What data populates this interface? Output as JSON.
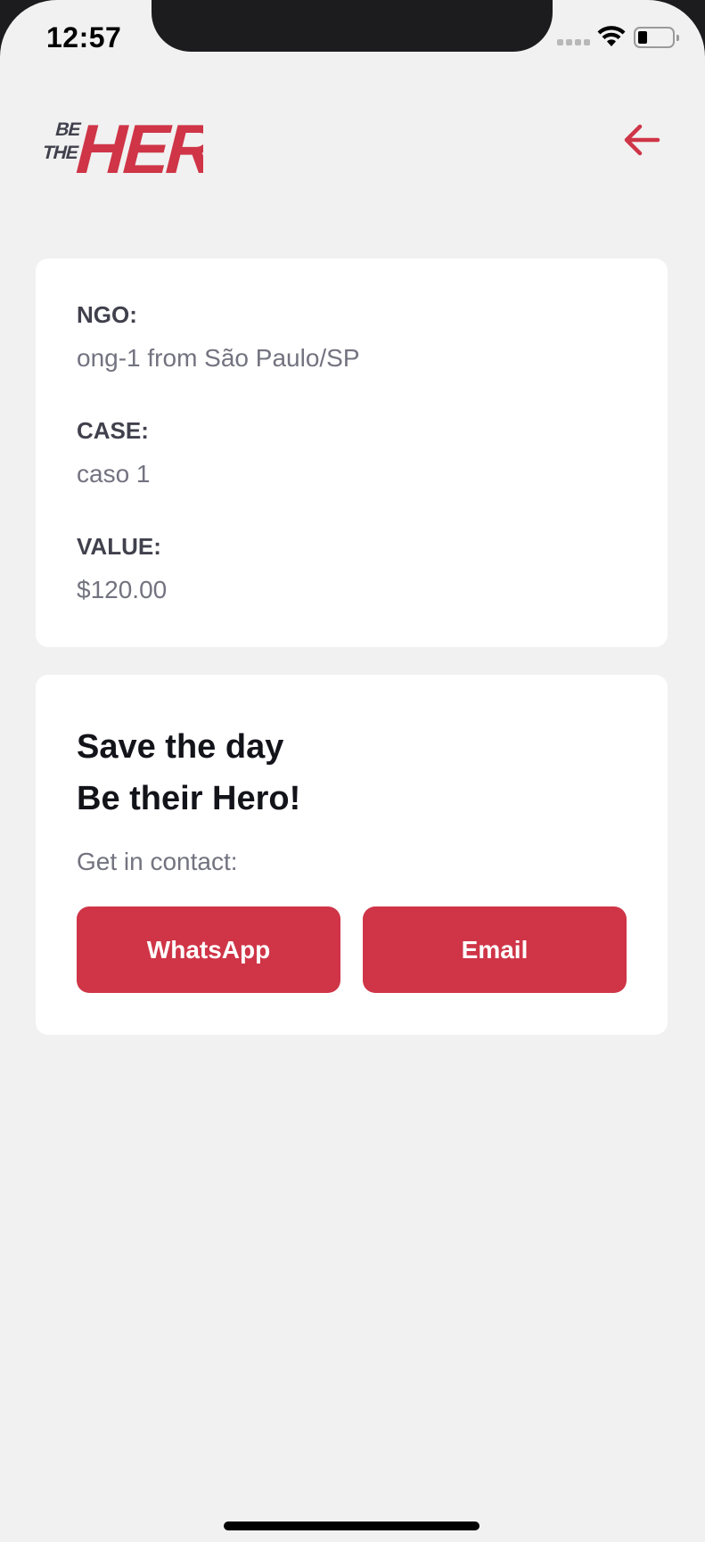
{
  "status_bar": {
    "time": "12:57"
  },
  "header": {
    "logo_alt": "BE THE HERO",
    "back_icon": "arrow-left-icon"
  },
  "incident": {
    "ngo_label": "NGO:",
    "ngo_value": "ong-1 from São Paulo/SP",
    "case_label": "CASE:",
    "case_value": "caso 1",
    "value_label": "VALUE:",
    "value_value": "$120.00"
  },
  "contact": {
    "title_line1": "Save the day",
    "title_line2": "Be their Hero!",
    "description": "Get in contact:",
    "whatsapp_label": "WhatsApp",
    "email_label": "Email"
  },
  "colors": {
    "brand_red": "#cf3547",
    "background": "#f1f1f1",
    "card": "#ffffff",
    "label": "#41414d",
    "value": "#737380"
  }
}
